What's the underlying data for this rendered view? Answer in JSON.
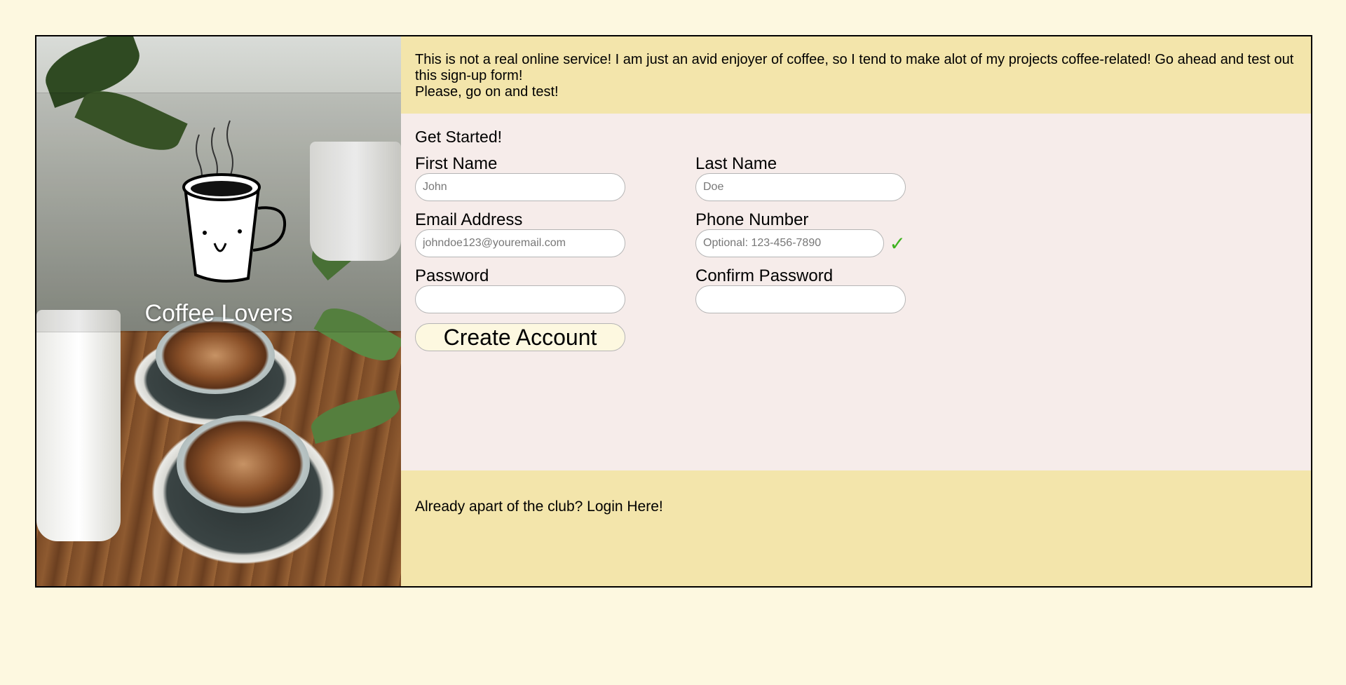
{
  "hero": {
    "brand": "Coffee Lovers",
    "image_icon": "coffee-cup-illustration"
  },
  "notice": {
    "line1": "This is not a real online service! I am just an avid enjoyer of coffee, so I tend to make alot of my projects coffee-related! Go ahead and test out this sign-up form!",
    "line2": "Please, go on and test!"
  },
  "form": {
    "title": "Get Started!",
    "first_name": {
      "label": "First Name",
      "placeholder": "John"
    },
    "last_name": {
      "label": "Last Name",
      "placeholder": "Doe"
    },
    "email": {
      "label": "Email Address",
      "placeholder": "johndoe123@youremail.com"
    },
    "phone": {
      "label": "Phone Number",
      "placeholder": "Optional: 123-456-7890",
      "valid_mark": "✓"
    },
    "password": {
      "label": "Password",
      "placeholder": ""
    },
    "confirm_password": {
      "label": "Confirm Password",
      "placeholder": ""
    },
    "submit_label": "Create Account"
  },
  "footer": {
    "text": "Already apart of the club?",
    "link_label": "Login Here!"
  },
  "colors": {
    "page_bg": "#fdf8e0",
    "banner_bg": "#f3e5ab",
    "form_bg": "#f6ecea",
    "valid_check": "#3fb31f"
  }
}
